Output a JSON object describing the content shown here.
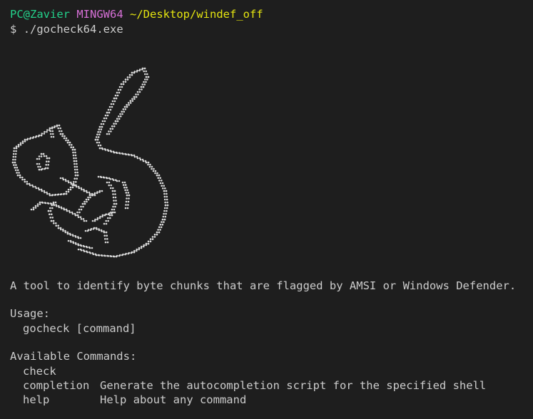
{
  "prompt": {
    "user_host": "PC@Zavier",
    "shell": "MINGW64",
    "path": "~/Desktop/windef_off",
    "symbol": "$",
    "command": "./gocheck64.exe"
  },
  "description": "A tool to identify byte chunks that are flagged by AMSI or Windows Defender.",
  "usage": {
    "heading": "Usage:",
    "syntax": "gocheck [command]"
  },
  "available_commands": {
    "heading": "Available Commands:",
    "commands": [
      {
        "name": "check",
        "description": ""
      },
      {
        "name": "completion",
        "description": "Generate the autocompletion script for the specified shell"
      },
      {
        "name": "help",
        "description": "Help about any command"
      }
    ]
  },
  "colors": {
    "background": "#1e1e1e",
    "foreground": "#cccccc",
    "user_host": "#23d18b",
    "shell": "#d670d6",
    "path": "#e5e510"
  }
}
